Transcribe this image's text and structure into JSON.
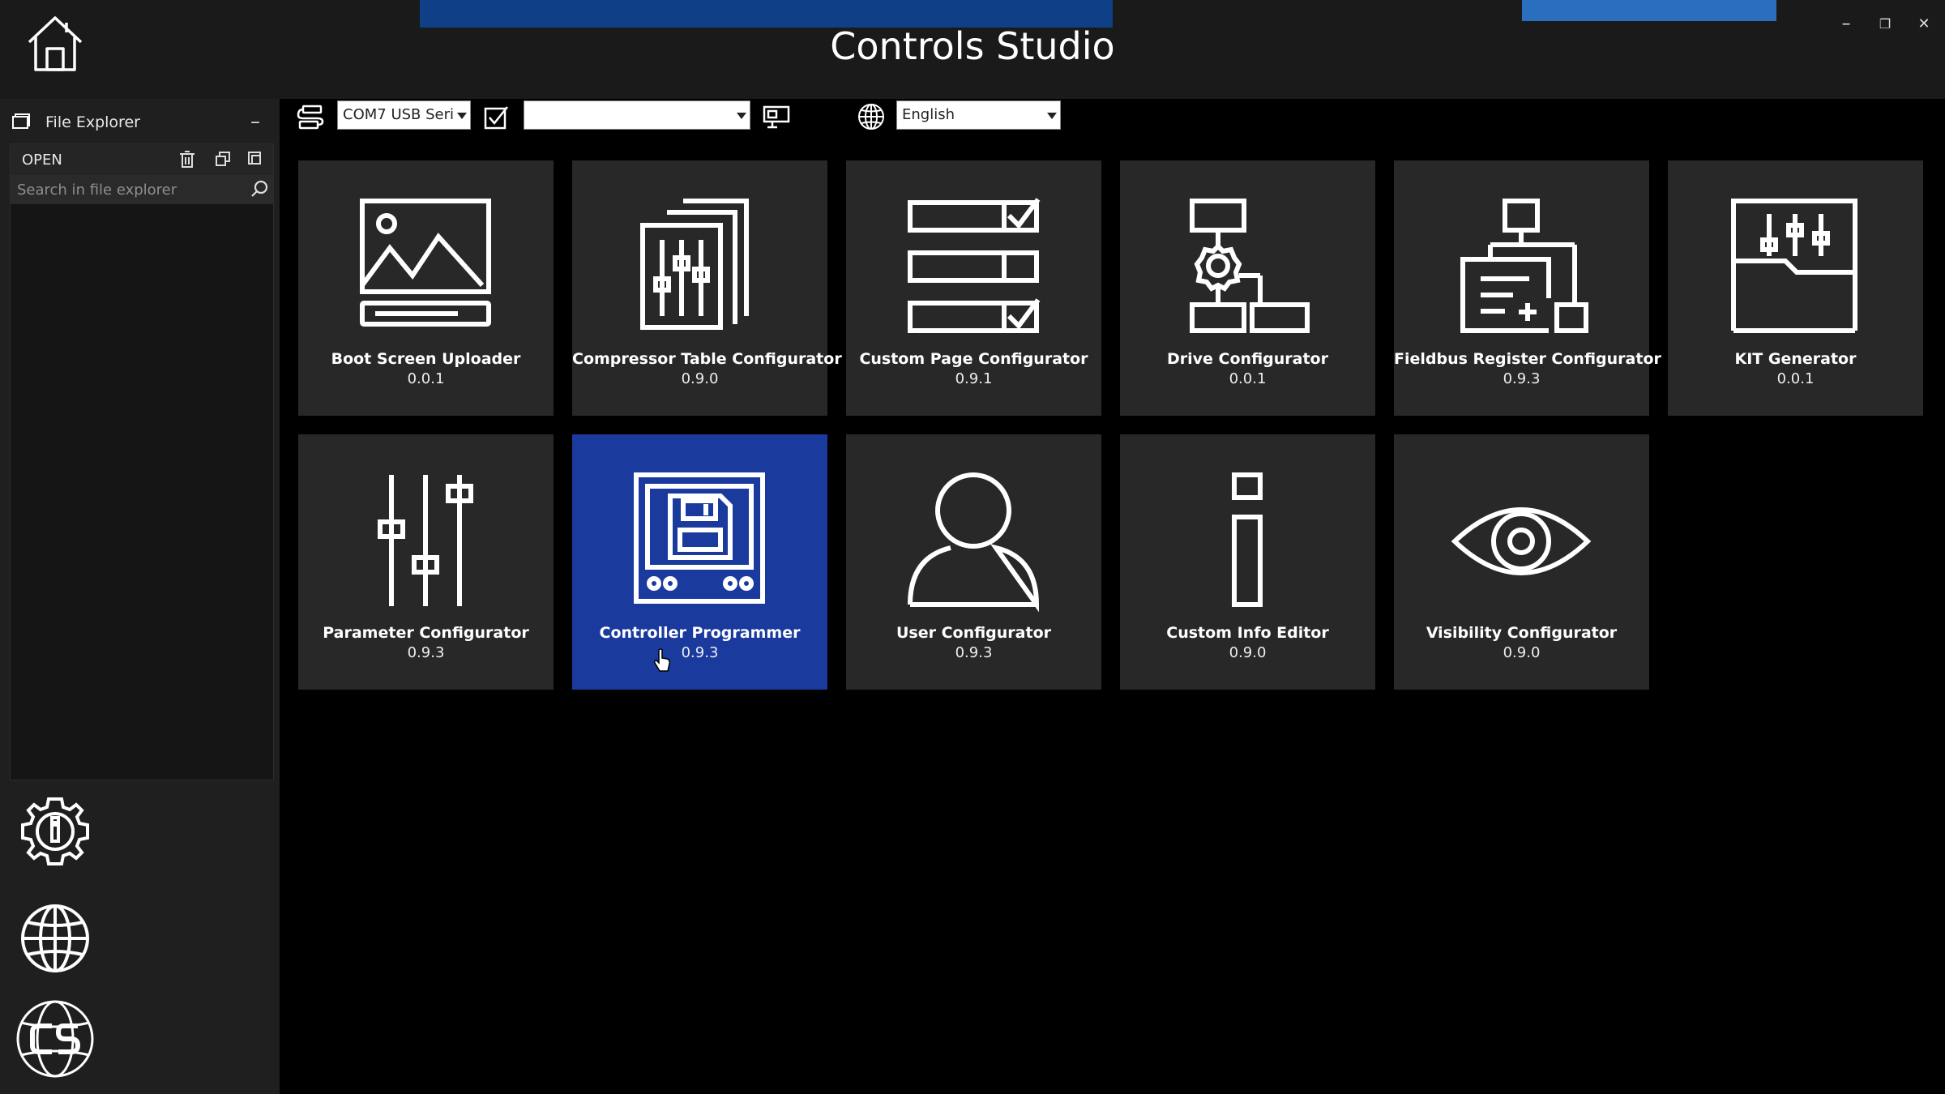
{
  "window": {
    "title": "Controls Studio",
    "controls": {
      "minimize": "–",
      "maximize": "❐",
      "close": "✕"
    }
  },
  "file_explorer": {
    "title": "File Explorer",
    "collapse_glyph": "–",
    "open_label": "OPEN",
    "search_placeholder": "Search in file explorer"
  },
  "toolbar": {
    "port_combo": "COM7 USB Seri",
    "device_combo": "",
    "language_combo": "English"
  },
  "sidebar": {
    "icons": [
      "settings-info-icon",
      "globe-icon",
      "cs-logo-icon"
    ]
  },
  "tiles": [
    {
      "name": "Boot Screen Uploader",
      "version": "0.0.1",
      "icon": "image-icon",
      "selected": false
    },
    {
      "name": "Compressor Table Configurator",
      "version": "0.9.0",
      "icon": "sliders-pages-icon",
      "selected": false
    },
    {
      "name": "Custom Page Configurator",
      "version": "0.9.1",
      "icon": "checklist-icon",
      "selected": false
    },
    {
      "name": "Drive Configurator",
      "version": "0.0.1",
      "icon": "gear-flowchart-icon",
      "selected": false
    },
    {
      "name": "Fieldbus Register Configurator",
      "version": "0.9.3",
      "icon": "register-tree-icon",
      "selected": false
    },
    {
      "name": "KIT Generator",
      "version": "0.0.1",
      "icon": "folder-sliders-icon",
      "selected": false
    },
    {
      "name": "Parameter Configurator",
      "version": "0.9.3",
      "icon": "sliders-icon",
      "selected": false
    },
    {
      "name": "Controller Programmer",
      "version": "0.9.3",
      "icon": "controller-save-icon",
      "selected": true
    },
    {
      "name": "User Configurator",
      "version": "0.9.3",
      "icon": "user-icon",
      "selected": false
    },
    {
      "name": "Custom Info Editor",
      "version": "0.9.0",
      "icon": "info-icon",
      "selected": false
    },
    {
      "name": "Visibility Configurator",
      "version": "0.9.0",
      "icon": "eye-icon",
      "selected": false
    }
  ],
  "colors": {
    "background": "#000000",
    "panel": "#1f1f1f",
    "tile": "#282828",
    "tile_selected": "#1a3a9e",
    "icon": "#ffffff"
  }
}
